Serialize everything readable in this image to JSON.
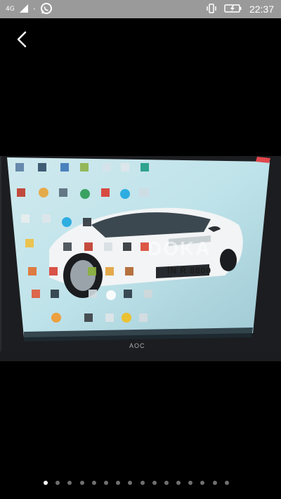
{
  "status_bar": {
    "network_type": "4G",
    "time": "22:37",
    "icons": [
      "signal-icon",
      "whatsapp-icon",
      "vibrate-icon",
      "battery-icon"
    ],
    "background_color": "#9a9a9a"
  },
  "photo": {
    "watermark": "DOKA",
    "plate": "IN R 8800",
    "monitor_brand": "AOC"
  },
  "pager": {
    "total": 16,
    "current": 1
  }
}
